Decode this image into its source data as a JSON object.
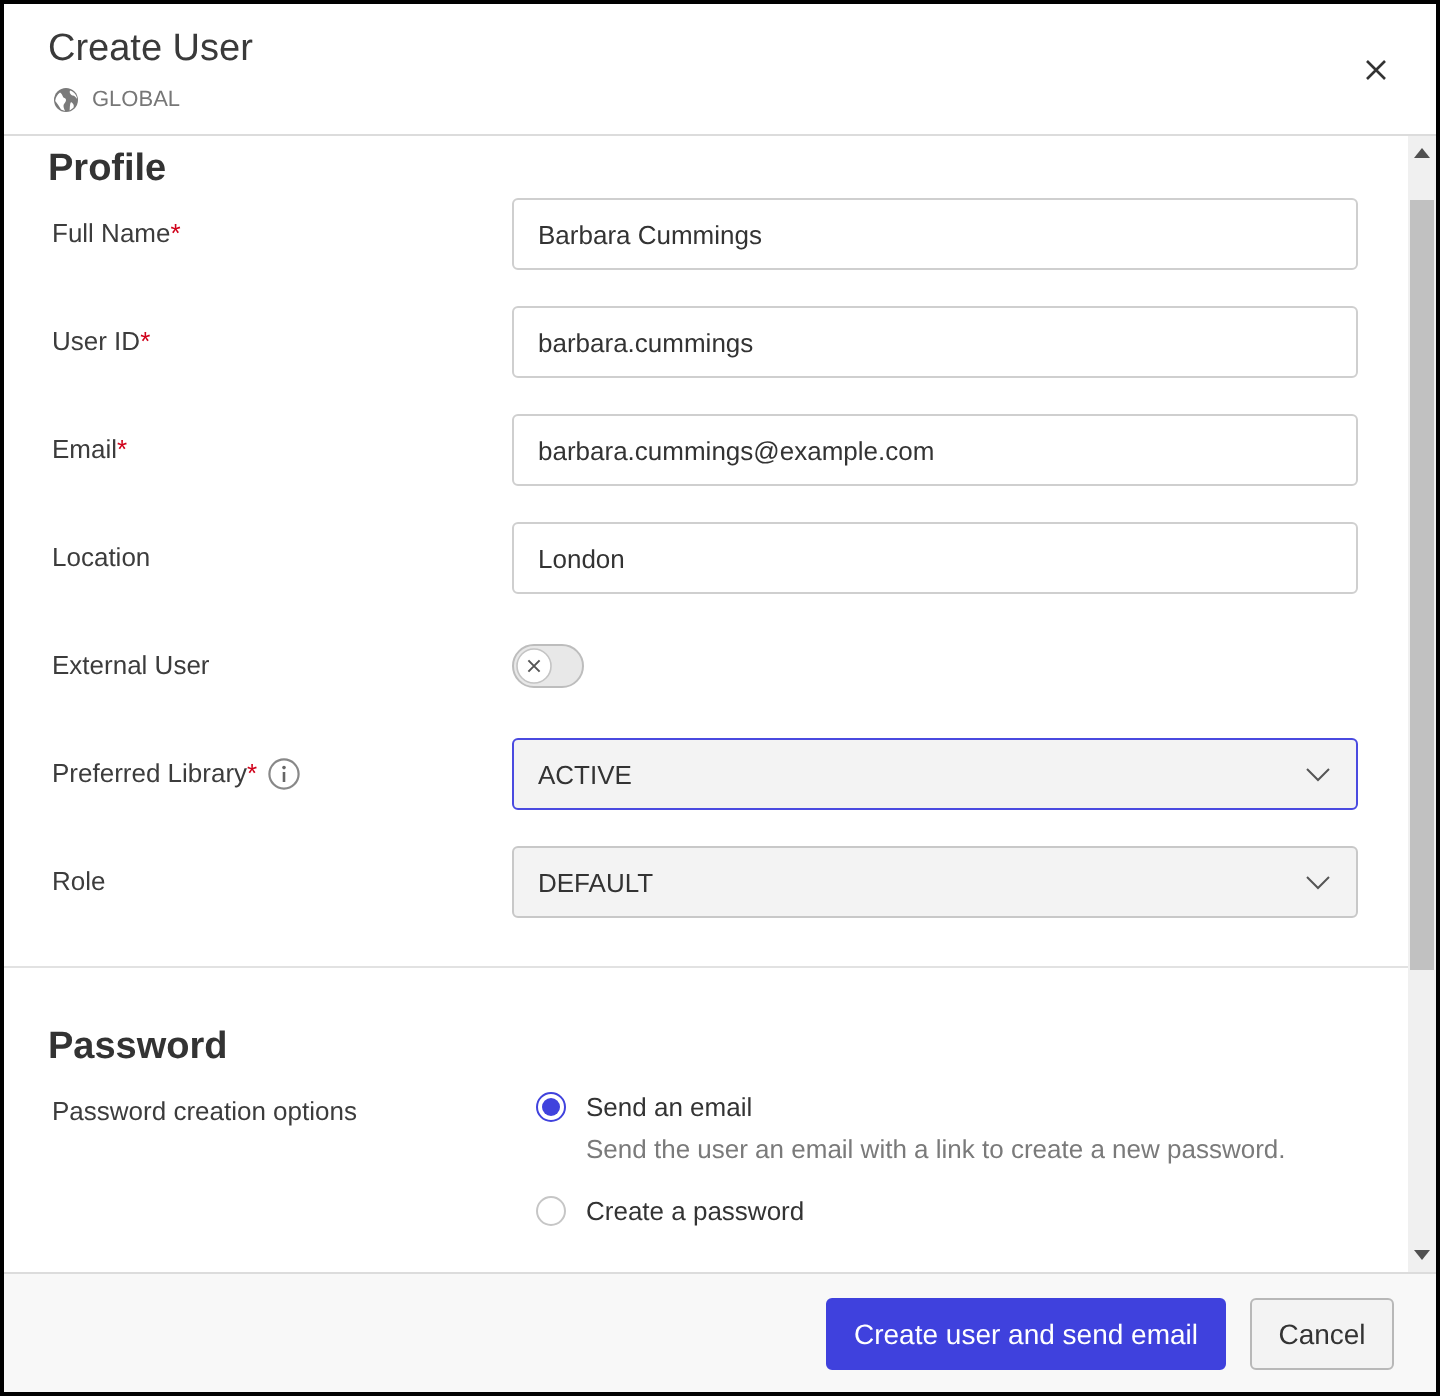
{
  "dialog": {
    "title": "Create User",
    "scope": "GLOBAL"
  },
  "profile": {
    "heading": "Profile",
    "fields": [
      {
        "kind": "text",
        "label": "Full Name",
        "required_mark": "*",
        "value": "Barbara Cummings",
        "focused": false
      },
      {
        "kind": "text",
        "label": "User ID",
        "required_mark": "*",
        "value": "barbara.cummings",
        "focused": false
      },
      {
        "kind": "text",
        "label": "Email",
        "required_mark": "*",
        "value": "barbara.cummings@example.com",
        "focused": false
      },
      {
        "kind": "text",
        "label": "Location",
        "value": "London",
        "focused": false
      },
      {
        "kind": "toggle",
        "label": "External User",
        "on": false
      },
      {
        "kind": "select",
        "label": "Preferred Library",
        "required_mark": "*",
        "info": true,
        "value": "ACTIVE",
        "focused": true
      },
      {
        "kind": "select",
        "label": "Role",
        "value": "DEFAULT",
        "focused": false
      }
    ]
  },
  "password": {
    "heading": "Password",
    "label": "Password creation options",
    "options": [
      {
        "label": "Send an email",
        "description": "Send the user an email with a link to create a new password.",
        "selected": true
      },
      {
        "label": "Create a password",
        "selected": false
      }
    ]
  },
  "footer": {
    "buttons": [
      {
        "kind": "primary",
        "label": "Create user and send email"
      },
      {
        "kind": "secondary",
        "label": "Cancel"
      }
    ]
  }
}
